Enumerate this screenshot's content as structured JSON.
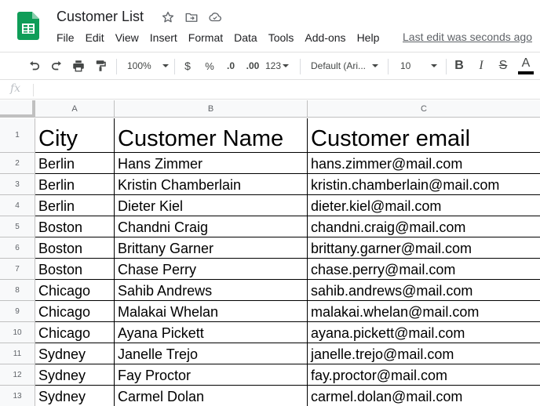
{
  "app": {
    "title": "Customer List",
    "last_edit": "Last edit was seconds ago",
    "menu": [
      "File",
      "Edit",
      "View",
      "Insert",
      "Format",
      "Data",
      "Tools",
      "Add-ons",
      "Help"
    ],
    "title_icons": [
      "star-icon",
      "move-to-folder-icon",
      "cloud-status-icon"
    ]
  },
  "toolbar": {
    "zoom": "100%",
    "currency": "$",
    "percent": "%",
    "decrease_decimal": ".0",
    "increase_decimal": ".00",
    "number_format": "123",
    "font": "Default (Ari...",
    "font_size": "10",
    "bold": "B",
    "italic": "I",
    "strike": "S",
    "text_color": "A"
  },
  "formula_bar": {
    "fx": "fx",
    "value": ""
  },
  "sheet": {
    "columns": [
      "A",
      "B",
      "C"
    ],
    "row_numbers": [
      "1",
      "2",
      "3",
      "4",
      "5",
      "6",
      "7",
      "8",
      "9",
      "10",
      "11",
      "12",
      "13"
    ],
    "header": [
      "City",
      "Customer Name",
      "Customer email"
    ],
    "rows": [
      [
        "Berlin",
        "Hans Zimmer",
        "hans.zimmer@mail.com"
      ],
      [
        "Berlin",
        "Kristin Chamberlain",
        "kristin.chamberlain@mail.com"
      ],
      [
        "Berlin",
        "Dieter Kiel",
        "dieter.kiel@mail.com"
      ],
      [
        "Boston",
        "Chandni Craig",
        "chandni.craig@mail.com"
      ],
      [
        "Boston",
        "Brittany Garner",
        "brittany.garner@mail.com"
      ],
      [
        "Boston",
        "Chase Perry",
        "chase.perry@mail.com"
      ],
      [
        "Chicago",
        "Sahib Andrews",
        "sahib.andrews@mail.com"
      ],
      [
        "Chicago",
        "Malakai Whelan",
        "malakai.whelan@mail.com"
      ],
      [
        "Chicago",
        "Ayana Pickett",
        "ayana.pickett@mail.com"
      ],
      [
        "Sydney",
        "Janelle Trejo",
        "janelle.trejo@mail.com"
      ],
      [
        "Sydney",
        "Fay Proctor",
        "fay.proctor@mail.com"
      ],
      [
        "Sydney",
        "Carmel Dolan",
        "carmel.dolan@mail.com"
      ]
    ]
  },
  "colors": {
    "sheets_green": "#0F9D58",
    "text_color_bar": "#000000"
  }
}
